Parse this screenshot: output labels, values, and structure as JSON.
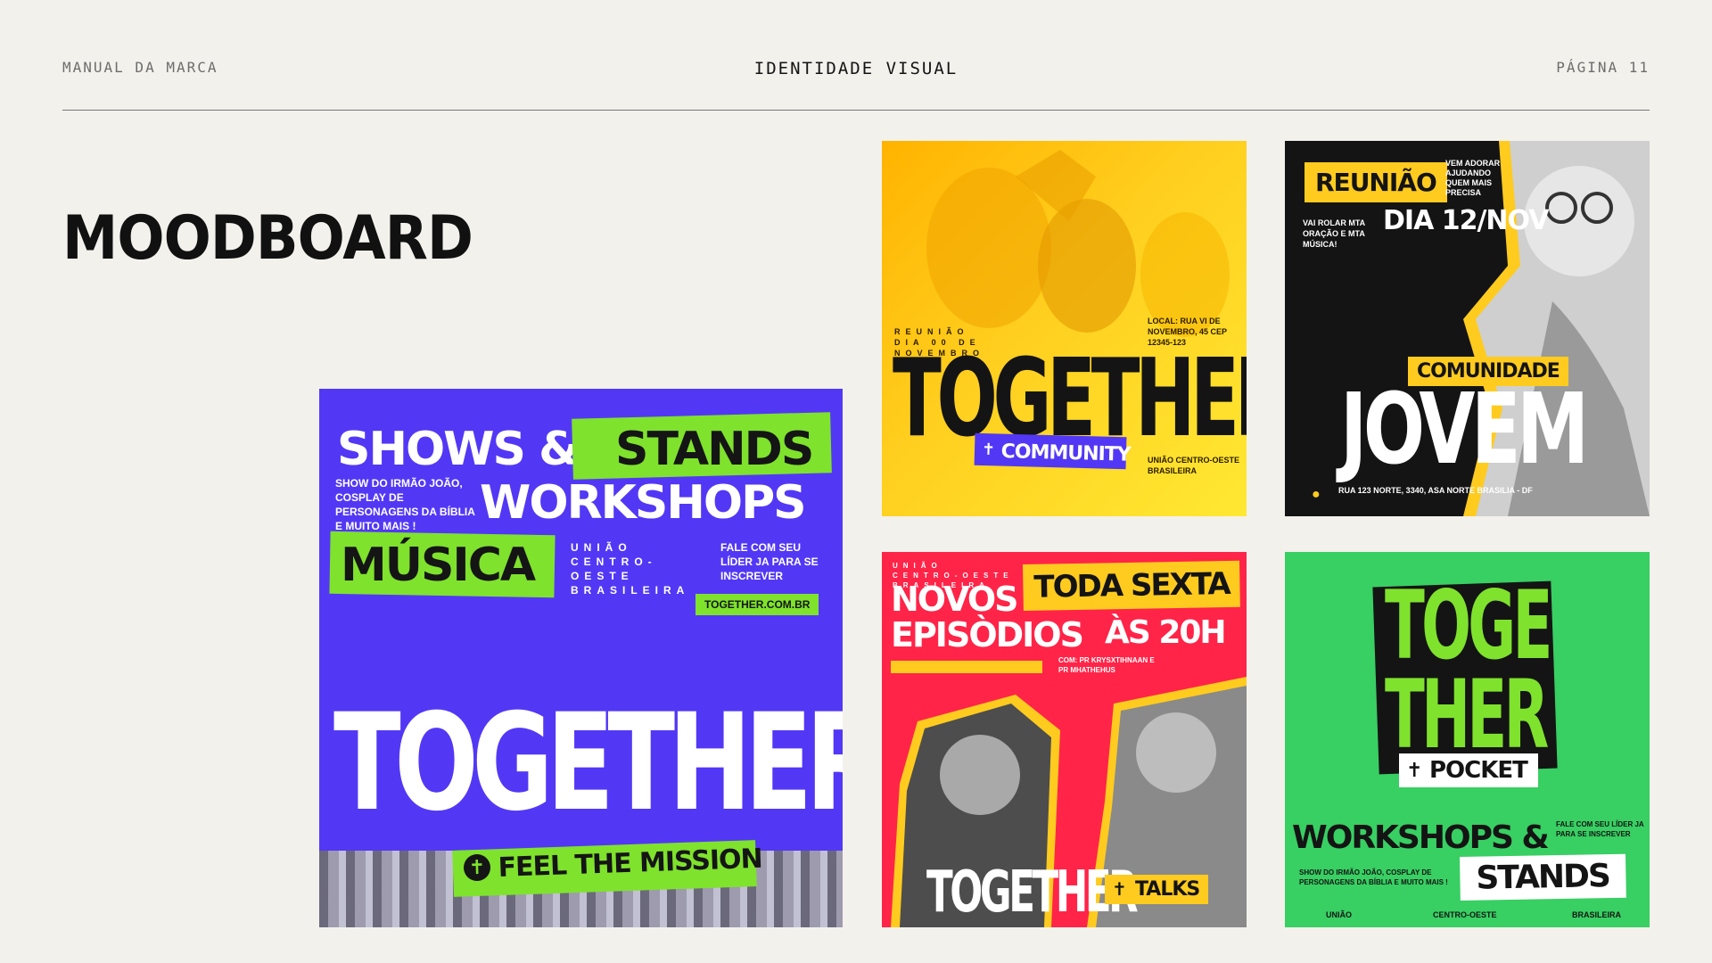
{
  "header": {
    "left": "MANUAL DA MARCA",
    "center": "IDENTIDADE VISUAL",
    "right": "PÁGINA 11"
  },
  "section_title": "MOODBOARD",
  "colors": {
    "background": "#f3f1ec",
    "purple": "#5238f5",
    "lime": "#7fe22d",
    "yellow": "#ffcb1f",
    "red": "#ff2448",
    "green": "#38cf63",
    "black": "#141414"
  },
  "card1": {
    "shows": "SHOWS &",
    "stands": "STANDS",
    "workshops": "WORKSHOPS &",
    "musica": "MÚSICA",
    "desc": "SHOW DO IRMÃO JOÃO, COSPLAY DE PERSONAGENS DA BÍBLIA E MUITO MAIS !",
    "org": "UNIÃO CENTRO-OESTE BRASILEIRA",
    "fale": "FALE COM SEU LÍDER JA PARA SE INSCREVER",
    "site": "TOGETHER.COM.BR",
    "brand": "TOGETHER",
    "tag": "FEEL THE MISSION"
  },
  "card2": {
    "left_info": "REUNIÃO DIA 00 DE NOVEMBRO",
    "right_info": "LOCAL: RUA VI DE NOVEMBRO, 45 CEP 12345-123",
    "brand": "TOGETHER",
    "tag": "COMMUNITY",
    "org": "UNIÃO CENTRO-OESTE BRASILEIRA"
  },
  "card3": {
    "reuniao": "REUNIÃO",
    "vem": "VEM ADORAR AJUDANDO QUEM MAIS PRECISA",
    "vai": "VAI ROLAR MTA ORAÇÃO E MTA MÚSICA!",
    "dia": "DIA 12/NOV",
    "comunidade": "COMUNIDADE",
    "jovem": "JOVEM",
    "address": "RUA 123 NORTE, 3340, ASA NORTE BRASILIA - DF"
  },
  "card4": {
    "org": "UNIÃO CENTRO-OESTE BRASILEIRA",
    "novos": "NOVOS",
    "episodios": "EPISÒDIOS",
    "toda": "TODA SEXTA",
    "horario": "ÀS 20H",
    "com": "COM: PR KRYSXTIHNAAN E PR MHATHEHUS",
    "brand": "TOGETHER",
    "tag": "TALKS"
  },
  "card5": {
    "toge": "TOGE",
    "ther": "THER",
    "tag": "POCKET",
    "workshops": "WORKSHOPS &",
    "fale": "FALE COM SEU LÍDER JA PARA SE INSCREVER",
    "desc": "SHOW DO IRMÃO JOÃO, COSPLAY DE PERSONAGENS DA BÍBLIA E MUITO MAIS !",
    "stands": "STANDS",
    "org1": "UNIÃO",
    "org2": "CENTRO-OESTE",
    "org3": "BRASILEIRA"
  }
}
